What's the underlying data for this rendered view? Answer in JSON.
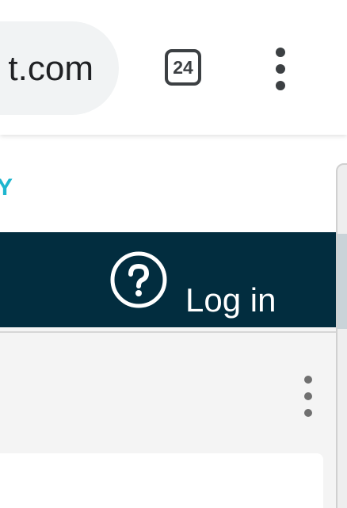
{
  "browser": {
    "url_display": "t.com",
    "tab_count": "24",
    "icons": {
      "tabs": "tab-switcher-icon",
      "menu": "more-vert-icon"
    },
    "colors": {
      "toolbar_bg": "#ffffff",
      "url_pill_bg": "#f1f3f4",
      "icon": "#3c4043"
    }
  },
  "site": {
    "logo_fragment": "Y",
    "nav": {
      "help_icon": "question-circle-icon",
      "login_label": "Log in"
    },
    "colors": {
      "logo": "#1eb6cf",
      "nav_bg": "#022d3f",
      "nav_text": "#ffffff",
      "page_bg": "#f4f4f4"
    },
    "overflow_icon": "more-vert-icon"
  }
}
